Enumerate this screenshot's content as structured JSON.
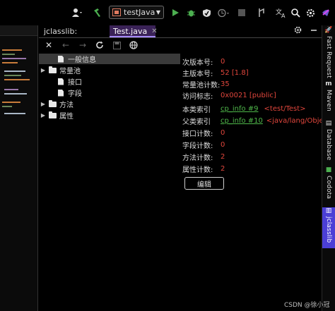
{
  "toolbar": {
    "user_icon": "user-icon",
    "run_config": "testJava",
    "icons": [
      "hammer-icon",
      "run-icon",
      "debug-icon",
      "coverage-icon",
      "profile-icon",
      "stop-icon",
      "vcs-icon",
      "translate-icon",
      "search-icon",
      "settings-icon",
      "plugin-icon"
    ]
  },
  "tabs": [
    {
      "label": "jclasslib:",
      "active": false
    },
    {
      "label": "Test.java",
      "active": true
    }
  ],
  "tree": [
    {
      "label": "一般信息",
      "type": "file",
      "expandable": false,
      "indent": 1,
      "selected": true
    },
    {
      "label": "常量池",
      "type": "folder",
      "expandable": true,
      "indent": 0,
      "selected": false
    },
    {
      "label": "接口",
      "type": "file",
      "expandable": false,
      "indent": 1,
      "selected": false
    },
    {
      "label": "字段",
      "type": "file",
      "expandable": false,
      "indent": 1,
      "selected": false
    },
    {
      "label": "方法",
      "type": "folder",
      "expandable": true,
      "indent": 0,
      "selected": false
    },
    {
      "label": "属性",
      "type": "folder",
      "expandable": true,
      "indent": 0,
      "selected": false
    }
  ],
  "info": [
    {
      "label": "次版本号:",
      "value": "0"
    },
    {
      "label": "主版本号:",
      "value": "52 [1.8]"
    },
    {
      "label": "常量池计数:",
      "value": "35"
    },
    {
      "label": "访问标志:",
      "value": "0x0021 [public]"
    },
    {
      "label": "本类索引",
      "link": "cp_info #9",
      "desc": "<test/Test>"
    },
    {
      "label": "父类索引",
      "link": "cp_info #10",
      "desc": "<java/lang/Object>"
    },
    {
      "label": "接口计数:",
      "value": "0"
    },
    {
      "label": "字段计数:",
      "value": "0"
    },
    {
      "label": "方法计数:",
      "value": "2"
    },
    {
      "label": "属性计数:",
      "value": "2"
    }
  ],
  "edit_button": "编辑",
  "right_tools": [
    {
      "label": "Fast Request",
      "icon": "rocket-icon",
      "active": false
    },
    {
      "label": "Maven",
      "icon": "maven-icon",
      "active": false
    },
    {
      "label": "Database",
      "icon": "database-icon",
      "active": false
    },
    {
      "label": "Codota",
      "icon": "codota-icon",
      "active": false
    },
    {
      "label": "jclasslib",
      "icon": "jclasslib-icon",
      "active": true
    }
  ],
  "watermark": "CSDN @徐小冠"
}
